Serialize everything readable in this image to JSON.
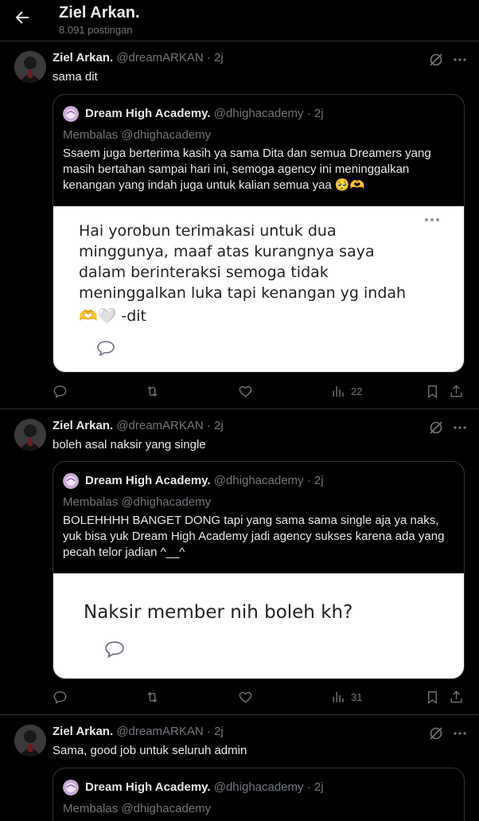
{
  "header": {
    "title": "Ziel Arkan.",
    "subtitle": "8.091 postingan"
  },
  "posts": [
    {
      "author_name": "Ziel Arkan.",
      "handle": "@dreamARKAN",
      "time": "· 2j",
      "text": "sama dit",
      "quote": {
        "author_name": "Dream High Academy.",
        "handle": "@dhighacademy",
        "time": "· 2j",
        "reply_to": "Membalas @dhighacademy",
        "text": "Ssaem juga berterima kasih ya sama Dita dan semua Dreamers yang masih bertahan sampai hari ini, semoga agency ini meninggalkan kenangan yang indah juga untuk kalian semua yaa 🥺🫶",
        "image_text": [
          "Hai yorobun terimakasi untuk dua",
          "minggunya, maaf atas kurangnya saya",
          "dalam berinteraksi semoga tidak",
          "meninggalkan luka tapi kenangan yg indah",
          "🫶🤍 -dit"
        ]
      },
      "views": "22"
    },
    {
      "author_name": "Ziel Arkan.",
      "handle": "@dreamARKAN",
      "time": "· 2j",
      "text": "boleh asal naksir yang single",
      "quote": {
        "author_name": "Dream High Academy.",
        "handle": "@dhighacademy",
        "time": "· 2j",
        "reply_to": "Membalas @dhighacademy",
        "text": "BOLEHHHH BANGET DONG tapi yang sama sama single aja ya naks, yuk bisa yuk Dream High Academy jadi agency sukses karena ada yang pecah telor jadian ^__^",
        "image_text": [
          "Naksir member nih boleh kh?"
        ]
      },
      "views": "31"
    },
    {
      "author_name": "Ziel Arkan.",
      "handle": "@dreamARKAN",
      "time": "· 2j",
      "text": "Sama, good job untuk seluruh admin",
      "quote": {
        "author_name": "Dream High Academy.",
        "handle": "@dhighacademy",
        "time": "· 2j",
        "reply_to": "Membalas @dhighacademy"
      }
    }
  ],
  "icons": {
    "back": "arrow-left-icon",
    "grok": "grok-icon",
    "more": "more-horizontal-icon",
    "reply": "reply-icon",
    "retweet": "retweet-icon",
    "like": "like-icon",
    "views": "views-icon",
    "bookmark": "bookmark-icon",
    "share": "share-icon"
  },
  "colors": {
    "background": "#000000",
    "text": "#e7e9ea",
    "secondary_text": "#71767b",
    "border": "#2f3336"
  }
}
